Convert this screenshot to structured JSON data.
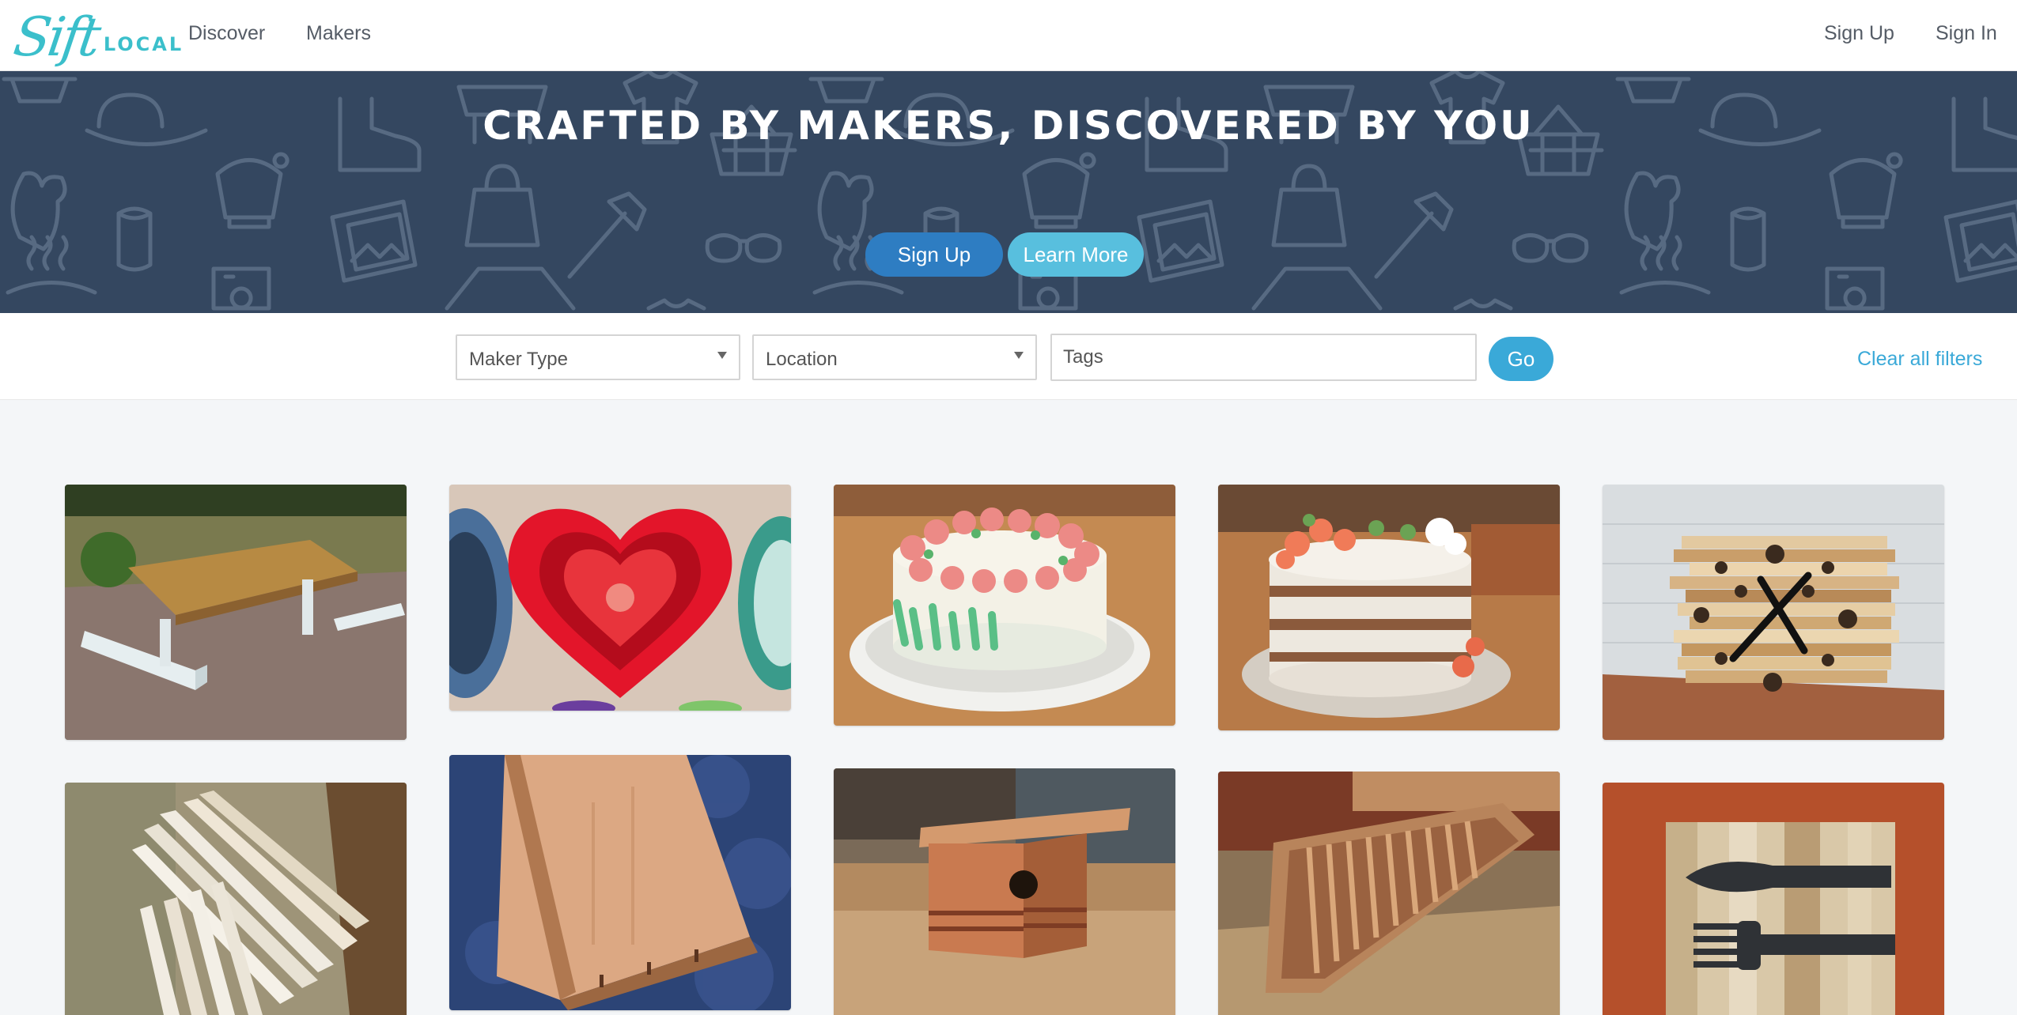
{
  "nav": {
    "logo_script": "Sift",
    "logo_text": "LOCAL",
    "links": [
      "Discover",
      "Makers"
    ],
    "auth": {
      "signup": "Sign Up",
      "signin": "Sign In"
    }
  },
  "hero": {
    "title": "CRAFTED BY MAKERS, DISCOVERED BY YOU",
    "signup_button": "Sign Up",
    "learn_more_button": "Learn More"
  },
  "filters": {
    "maker_type": "Maker Type",
    "location": "Location",
    "tags_placeholder": "Tags",
    "go_button": "Go",
    "clear_all": "Clear all filters"
  },
  "colors": {
    "brand": "#3bbfcb",
    "hero_bg": "#344760",
    "primary_button": "#2e7dc2",
    "secondary_button": "#58bfde",
    "link": "#3aa9d8"
  },
  "gallery": [
    {
      "subject": "picnic-table"
    },
    {
      "subject": "heart-bowls"
    },
    {
      "subject": "rose-cake"
    },
    {
      "subject": "naked-cake"
    },
    {
      "subject": "wood-clock"
    },
    {
      "subject": "wood-slats"
    },
    {
      "subject": "cherry-box"
    },
    {
      "subject": "birdhouse"
    },
    {
      "subject": "wood-tray"
    },
    {
      "subject": "fork-knife-art"
    }
  ]
}
